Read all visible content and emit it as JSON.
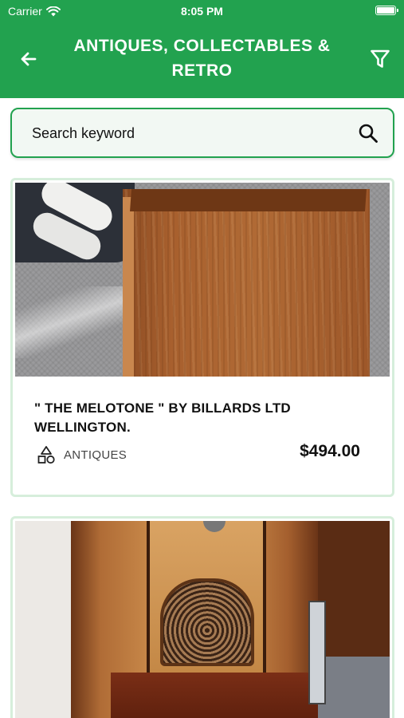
{
  "status_bar": {
    "carrier": "Carrier",
    "time": "8:05 PM"
  },
  "nav": {
    "title": "ANTIQUES, COLLECTABLES & RETRO",
    "back_icon": "arrow-left-icon",
    "filter_icon": "filter-icon"
  },
  "search": {
    "placeholder": "Search keyword",
    "value": "",
    "icon": "search-icon"
  },
  "listings": [
    {
      "title": "\" THE MELOTONE \" BY BILLARDS LTD WELLINGTON.",
      "category": "ANTIQUES",
      "category_icon": "shapes-icon",
      "price": "$494.00"
    },
    {
      "title": "",
      "category": "",
      "price": ""
    }
  ],
  "colors": {
    "brand_green": "#22a24f",
    "card_border": "#d6eedb",
    "search_bg": "#f2f8f3"
  }
}
